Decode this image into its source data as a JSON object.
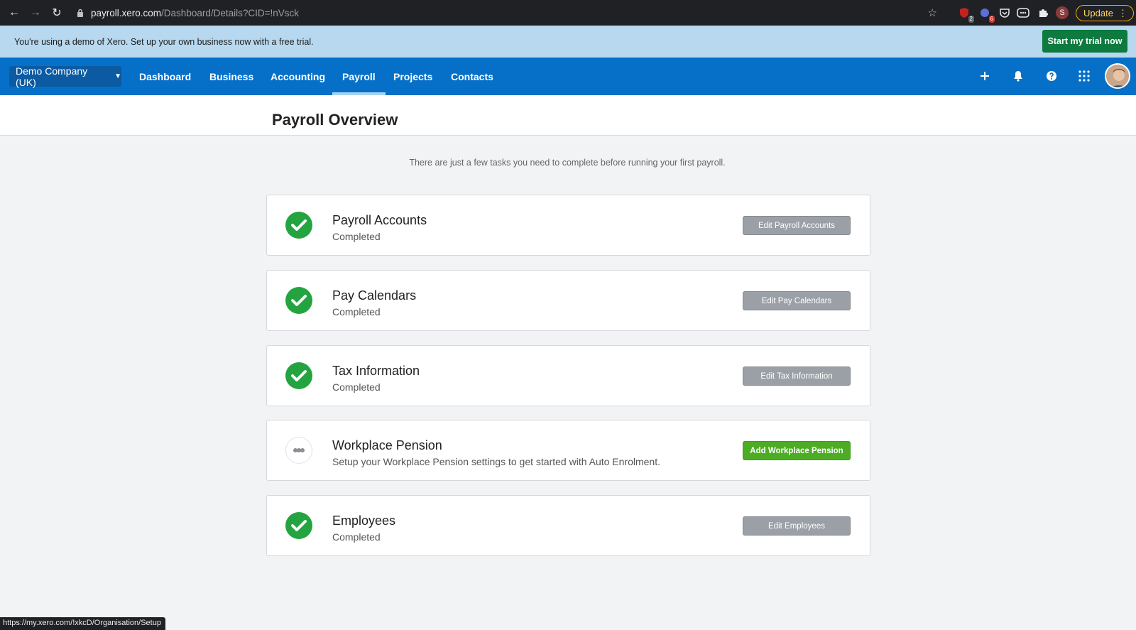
{
  "browser": {
    "url_host": "payroll.xero.com",
    "url_path": "/Dashboard/Details?CID=!nVsck",
    "status_url": "https://my.xero.com/!xkcD/Organisation/Setup",
    "profile_initial": "S",
    "update_label": "Update",
    "ext_badges": [
      "2",
      "6"
    ]
  },
  "demo_banner": {
    "message": "You're using a demo of Xero. Set up your own business now with a free trial.",
    "cta": "Start my trial now"
  },
  "nav": {
    "org": "Demo Company (UK)",
    "items": [
      {
        "label": "Dashboard"
      },
      {
        "label": "Business"
      },
      {
        "label": "Accounting"
      },
      {
        "label": "Payroll",
        "active": true
      },
      {
        "label": "Projects"
      },
      {
        "label": "Contacts"
      }
    ],
    "icons": [
      "plus-icon",
      "bell-icon",
      "help-icon",
      "apps-grid-icon"
    ]
  },
  "page": {
    "title": "Payroll Overview",
    "intro": "There are just a few tasks you need to complete before running your first payroll."
  },
  "tasks": [
    {
      "title": "Payroll Accounts",
      "subtitle": "Completed",
      "button": "Edit Payroll Accounts",
      "status": "done"
    },
    {
      "title": "Pay Calendars",
      "subtitle": "Completed",
      "button": "Edit Pay Calendars",
      "status": "done"
    },
    {
      "title": "Tax Information",
      "subtitle": "Completed",
      "button": "Edit Tax Information",
      "status": "done"
    },
    {
      "title": "Workplace Pension",
      "subtitle": "Setup your Workplace Pension settings to get started with Auto Enrolment.",
      "button": "Add Workplace Pension",
      "status": "pending"
    },
    {
      "title": "Employees",
      "subtitle": "Completed",
      "button": "Edit Employees",
      "status": "done"
    }
  ],
  "colors": {
    "nav_bg": "#0670c8",
    "banner_bg": "#b7d8ee",
    "done_green": "#23a440",
    "add_green": "#4cac24"
  }
}
